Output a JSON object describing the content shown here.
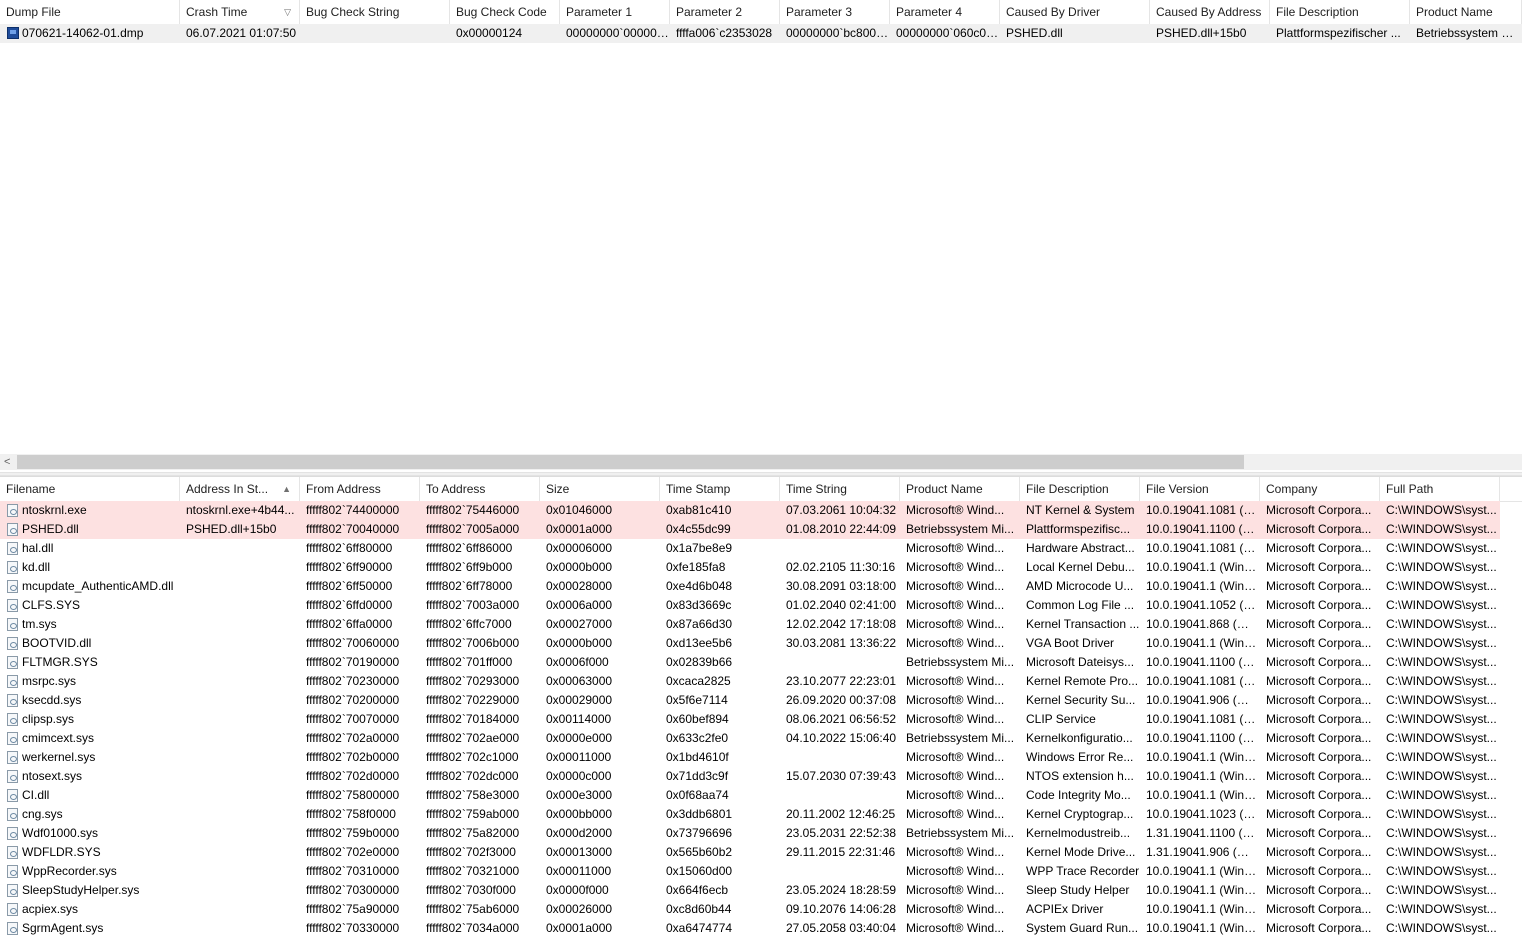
{
  "top": {
    "columns": [
      "Dump File",
      "Crash Time",
      "Bug Check String",
      "Bug Check Code",
      "Parameter 1",
      "Parameter 2",
      "Parameter 3",
      "Parameter 4",
      "Caused By Driver",
      "Caused By Address",
      "File Description",
      "Product Name"
    ],
    "sort_indicator": "▽",
    "rows": [
      [
        "070621-14062-01.dmp",
        "06.07.2021 01:07:50",
        "",
        "0x00000124",
        "00000000`000000...",
        "ffffa006`c2353028",
        "00000000`bc8008...",
        "00000000`060c08...",
        "PSHED.dll",
        "PSHED.dll+15b0",
        "Plattformspezifischer ...",
        "Betriebssystem Micr"
      ]
    ],
    "scroll_left_arrow": "<"
  },
  "bottom": {
    "columns": [
      "Filename",
      "Address In St...",
      "From Address",
      "To Address",
      "Size",
      "Time Stamp",
      "Time String",
      "Product Name",
      "File Description",
      "File Version",
      "Company",
      "Full Path"
    ],
    "sort_indicator": "▲",
    "rows": [
      [
        "ntoskrnl.exe",
        "ntoskrnl.exe+4b44...",
        "fffff802`74400000",
        "fffff802`75446000",
        "0x01046000",
        "0xab81c410",
        "07.03.2061 10:04:32",
        "Microsoft® Wind...",
        "NT Kernel & System",
        "10.0.19041.1081 (W...",
        "Microsoft Corpora...",
        "C:\\WINDOWS\\syst..."
      ],
      [
        "PSHED.dll",
        "PSHED.dll+15b0",
        "fffff802`70040000",
        "fffff802`7005a000",
        "0x0001a000",
        "0x4c55dc99",
        "01.08.2010 22:44:09",
        "Betriebssystem Mi...",
        "Plattformspezifisc...",
        "10.0.19041.1100 (W...",
        "Microsoft Corpora...",
        "C:\\WINDOWS\\syst..."
      ],
      [
        "hal.dll",
        "",
        "fffff802`6ff80000",
        "fffff802`6ff86000",
        "0x00006000",
        "0x1a7be8e9",
        "",
        "Microsoft® Wind...",
        "Hardware Abstract...",
        "10.0.19041.1081 (W...",
        "Microsoft Corpora...",
        "C:\\WINDOWS\\syst..."
      ],
      [
        "kd.dll",
        "",
        "fffff802`6ff90000",
        "fffff802`6ff9b000",
        "0x0000b000",
        "0xfe185fa8",
        "02.02.2105 11:30:16",
        "Microsoft® Wind...",
        "Local Kernel Debu...",
        "10.0.19041.1 (WinB...",
        "Microsoft Corpora...",
        "C:\\WINDOWS\\syst..."
      ],
      [
        "mcupdate_AuthenticAMD.dll",
        "",
        "fffff802`6ff50000",
        "fffff802`6ff78000",
        "0x00028000",
        "0xe4d6b048",
        "30.08.2091 03:18:00",
        "Microsoft® Wind...",
        "AMD Microcode U...",
        "10.0.19041.1 (WinB...",
        "Microsoft Corpora...",
        "C:\\WINDOWS\\syst..."
      ],
      [
        "CLFS.SYS",
        "",
        "fffff802`6ffd0000",
        "fffff802`7003a000",
        "0x0006a000",
        "0x83d3669c",
        "01.02.2040 02:41:00",
        "Microsoft® Wind...",
        "Common Log File ...",
        "10.0.19041.1052 (W...",
        "Microsoft Corpora...",
        "C:\\WINDOWS\\syst..."
      ],
      [
        "tm.sys",
        "",
        "fffff802`6ffa0000",
        "fffff802`6ffc7000",
        "0x00027000",
        "0x87a66d30",
        "12.02.2042 17:18:08",
        "Microsoft® Wind...",
        "Kernel Transaction ...",
        "10.0.19041.868 (Wi...",
        "Microsoft Corpora...",
        "C:\\WINDOWS\\syst..."
      ],
      [
        "BOOTVID.dll",
        "",
        "fffff802`70060000",
        "fffff802`7006b000",
        "0x0000b000",
        "0xd13ee5b6",
        "30.03.2081 13:36:22",
        "Microsoft® Wind...",
        "VGA Boot Driver",
        "10.0.19041.1 (WinB...",
        "Microsoft Corpora...",
        "C:\\WINDOWS\\syst..."
      ],
      [
        "FLTMGR.SYS",
        "",
        "fffff802`70190000",
        "fffff802`701ff000",
        "0x0006f000",
        "0x02839b66",
        "",
        "Betriebssystem Mi...",
        "Microsoft Dateisys...",
        "10.0.19041.1100 (W...",
        "Microsoft Corpora...",
        "C:\\WINDOWS\\syst..."
      ],
      [
        "msrpc.sys",
        "",
        "fffff802`70230000",
        "fffff802`70293000",
        "0x00063000",
        "0xcaca2825",
        "23.10.2077 22:23:01",
        "Microsoft® Wind...",
        "Kernel Remote Pro...",
        "10.0.19041.1081 (W...",
        "Microsoft Corpora...",
        "C:\\WINDOWS\\syst..."
      ],
      [
        "ksecdd.sys",
        "",
        "fffff802`70200000",
        "fffff802`70229000",
        "0x00029000",
        "0x5f6e7114",
        "26.09.2020 00:37:08",
        "Microsoft® Wind...",
        "Kernel Security Su...",
        "10.0.19041.906 (Wi...",
        "Microsoft Corpora...",
        "C:\\WINDOWS\\syst..."
      ],
      [
        "clipsp.sys",
        "",
        "fffff802`70070000",
        "fffff802`70184000",
        "0x00114000",
        "0x60bef894",
        "08.06.2021 06:56:52",
        "Microsoft® Wind...",
        "CLIP Service",
        "10.0.19041.1081 (W...",
        "Microsoft Corpora...",
        "C:\\WINDOWS\\syst..."
      ],
      [
        "cmimcext.sys",
        "",
        "fffff802`702a0000",
        "fffff802`702ae000",
        "0x0000e000",
        "0x633c2fe0",
        "04.10.2022 15:06:40",
        "Betriebssystem Mi...",
        "Kernelkonfiguratio...",
        "10.0.19041.1100 (W...",
        "Microsoft Corpora...",
        "C:\\WINDOWS\\syst..."
      ],
      [
        "werkernel.sys",
        "",
        "fffff802`702b0000",
        "fffff802`702c1000",
        "0x00011000",
        "0x1bd4610f",
        "",
        "Microsoft® Wind...",
        "Windows Error Re...",
        "10.0.19041.1 (WinB...",
        "Microsoft Corpora...",
        "C:\\WINDOWS\\syst..."
      ],
      [
        "ntosext.sys",
        "",
        "fffff802`702d0000",
        "fffff802`702dc000",
        "0x0000c000",
        "0x71dd3c9f",
        "15.07.2030 07:39:43",
        "Microsoft® Wind...",
        "NTOS extension h...",
        "10.0.19041.1 (WinB...",
        "Microsoft Corpora...",
        "C:\\WINDOWS\\syst..."
      ],
      [
        "CI.dll",
        "",
        "fffff802`75800000",
        "fffff802`758e3000",
        "0x000e3000",
        "0x0f68aa74",
        "",
        "Microsoft® Wind...",
        "Code Integrity Mo...",
        "10.0.19041.1 (WinB...",
        "Microsoft Corpora...",
        "C:\\WINDOWS\\syst..."
      ],
      [
        "cng.sys",
        "",
        "fffff802`758f0000",
        "fffff802`759ab000",
        "0x000bb000",
        "0x3ddb6801",
        "20.11.2002 12:46:25",
        "Microsoft® Wind...",
        "Kernel Cryptograp...",
        "10.0.19041.1023 (W...",
        "Microsoft Corpora...",
        "C:\\WINDOWS\\syst..."
      ],
      [
        "Wdf01000.sys",
        "",
        "fffff802`759b0000",
        "fffff802`75a82000",
        "0x000d2000",
        "0x73796696",
        "23.05.2031 22:52:38",
        "Betriebssystem Mi...",
        "Kernelmodustreib...",
        "1.31.19041.1100 (W...",
        "Microsoft Corpora...",
        "C:\\WINDOWS\\syst..."
      ],
      [
        "WDFLDR.SYS",
        "",
        "fffff802`702e0000",
        "fffff802`702f3000",
        "0x00013000",
        "0x565b60b2",
        "29.11.2015 22:31:46",
        "Microsoft® Wind...",
        "Kernel Mode Drive...",
        "1.31.19041.906 (Wi...",
        "Microsoft Corpora...",
        "C:\\WINDOWS\\syst..."
      ],
      [
        "WppRecorder.sys",
        "",
        "fffff802`70310000",
        "fffff802`70321000",
        "0x00011000",
        "0x15060d00",
        "",
        "Microsoft® Wind...",
        "WPP Trace Recorder",
        "10.0.19041.1 (WinB...",
        "Microsoft Corpora...",
        "C:\\WINDOWS\\syst..."
      ],
      [
        "SleepStudyHelper.sys",
        "",
        "fffff802`70300000",
        "fffff802`7030f000",
        "0x0000f000",
        "0x664f6ecb",
        "23.05.2024 18:28:59",
        "Microsoft® Wind...",
        "Sleep Study Helper",
        "10.0.19041.1 (WinB...",
        "Microsoft Corpora...",
        "C:\\WINDOWS\\syst..."
      ],
      [
        "acpiex.sys",
        "",
        "fffff802`75a90000",
        "fffff802`75ab6000",
        "0x00026000",
        "0xc8d60b44",
        "09.10.2076 14:06:28",
        "Microsoft® Wind...",
        "ACPIEx Driver",
        "10.0.19041.1 (WinB...",
        "Microsoft Corpora...",
        "C:\\WINDOWS\\syst..."
      ],
      [
        "SgrmAgent.sys",
        "",
        "fffff802`70330000",
        "fffff802`7034a000",
        "0x0001a000",
        "0xa6474774",
        "27.05.2058 03:40:04",
        "Microsoft® Wind...",
        "System Guard Run...",
        "10.0.19041.1 (WinB...",
        "Microsoft Corpora...",
        "C:\\WINDOWS\\syst..."
      ]
    ],
    "highlighted_rows": 2
  },
  "colors": {
    "highlight": "#fde1e1",
    "selected": "#f0f0f0",
    "grid": "#e5e5e5"
  }
}
